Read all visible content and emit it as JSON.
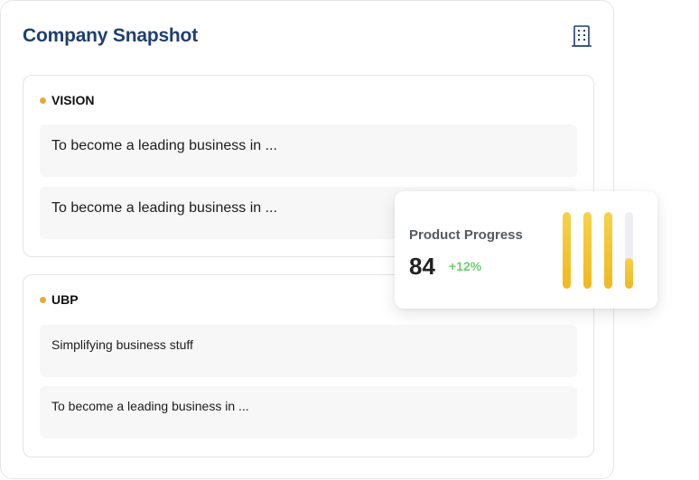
{
  "header": {
    "title": "Company Snapshot",
    "icon": "building-icon"
  },
  "vision": {
    "label": "VISION",
    "items": [
      "To become a leading business in ...",
      "To become a leading business in ..."
    ]
  },
  "ubp": {
    "label": "UBP",
    "items": [
      "Simplifying business stuff",
      "To become a leading business in ..."
    ]
  },
  "product_progress": {
    "title": "Product Progress",
    "value": "84",
    "change": "+12%",
    "bar_levels": [
      1.0,
      1.0,
      1.0,
      0.4
    ]
  },
  "colors": {
    "title": "#1f3f6e",
    "accent_dot": "#e6a93a",
    "bar_fill": "#f0b91f",
    "positive_change": "#6ccf6c"
  }
}
